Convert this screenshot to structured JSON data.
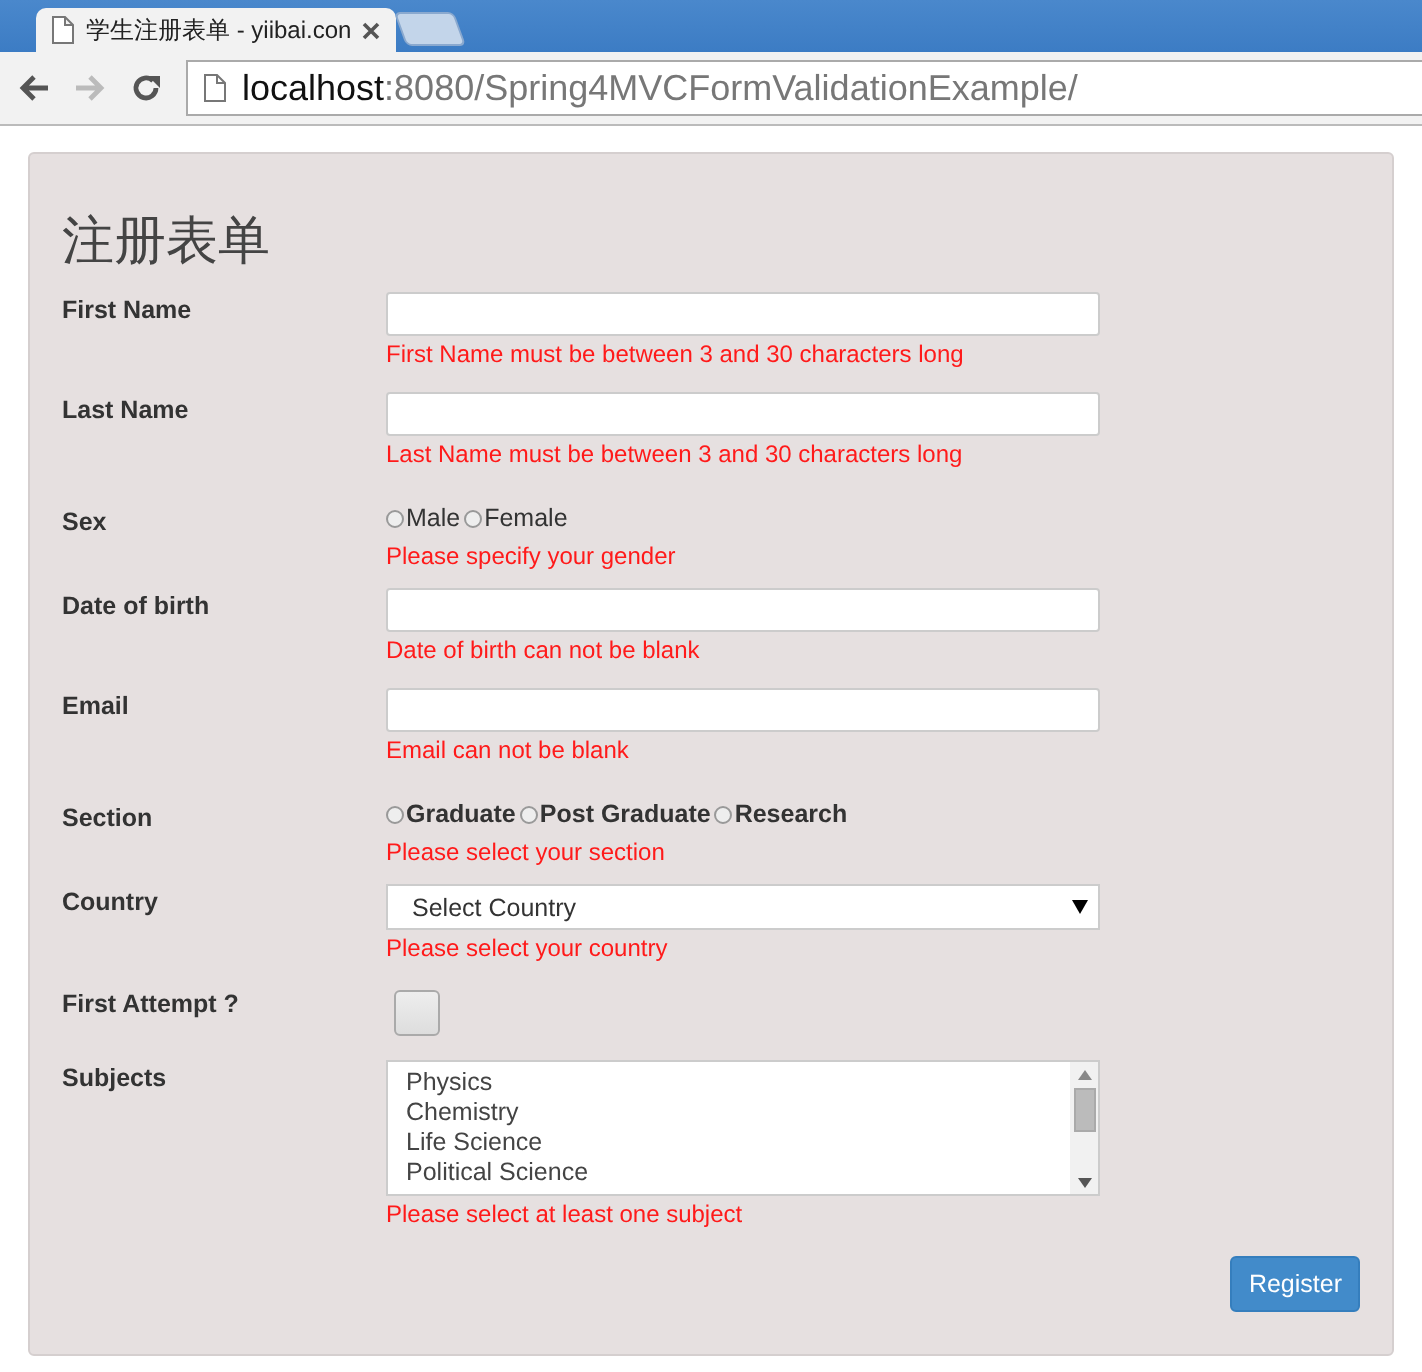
{
  "browser": {
    "tabs": [
      {
        "title": "学生注册表单 - yiibai.con",
        "selected": true
      }
    ],
    "address": {
      "host": "localhost",
      "path": ":8080/Spring4MVCFormValidationExample/"
    }
  },
  "form": {
    "title": "注册表单",
    "fields": [
      {
        "kind": "text",
        "label": "First Name",
        "error": "First Name must be between 3 and 30 characters long"
      },
      {
        "kind": "text",
        "label": "Last Name",
        "error": "Last Name must be between 3 and 30 characters long"
      },
      {
        "kind": "radio",
        "label": "Sex",
        "bold_options": false,
        "options": [
          {
            "label": "Male",
            "selected": false
          },
          {
            "label": "Female",
            "selected": false
          }
        ],
        "error": "Please specify your gender"
      },
      {
        "kind": "text",
        "label": "Date of birth",
        "error": "Date of birth can not be blank"
      },
      {
        "kind": "text",
        "label": "Email",
        "error": "Email can not be blank"
      },
      {
        "kind": "radio",
        "label": "Section",
        "bold_options": true,
        "options": [
          {
            "label": "Graduate",
            "selected": false
          },
          {
            "label": "Post Graduate",
            "selected": false
          },
          {
            "label": "Research",
            "selected": false
          }
        ],
        "error": "Please select your section"
      },
      {
        "kind": "select",
        "label": "Country",
        "value": "Select Country",
        "error": "Please select your country"
      },
      {
        "kind": "checkbox",
        "label": "First Attempt ?",
        "checked": false
      },
      {
        "kind": "listbox",
        "label": "Subjects",
        "options": [
          "Physics",
          "Chemistry",
          "Life Science",
          "Political Science"
        ],
        "error": "Please select at least one subject"
      }
    ],
    "submit": "Register"
  }
}
